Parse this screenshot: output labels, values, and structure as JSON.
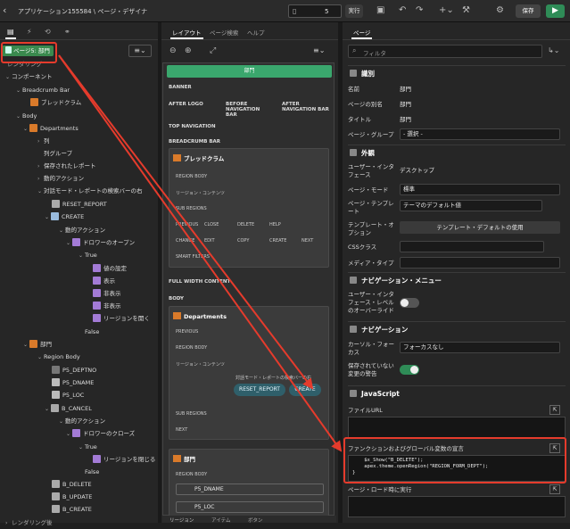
{
  "header": {
    "app_title": "アプリケーション155584 \\ ページ・デザイナ",
    "page_number": "5",
    "run_label": "実行",
    "save_label": "保存"
  },
  "left": {
    "page_chip": "ページ5: 部門",
    "items": [
      {
        "label": "レンダリング",
        "muted": true
      },
      {
        "label": "コンポーネント"
      },
      {
        "label": "Breadcrumb Bar"
      },
      {
        "label": "ブレッドクラム"
      },
      {
        "label": "Body"
      },
      {
        "label": "Departments"
      },
      {
        "label": "列"
      },
      {
        "label": "列グループ"
      },
      {
        "label": "保存されたレポート"
      },
      {
        "label": "動的アクション"
      },
      {
        "label": "対話モード・レポートの検索バーの右"
      },
      {
        "label": "RESET_REPORT"
      },
      {
        "label": "CREATE"
      },
      {
        "label": "動的アクション"
      },
      {
        "label": "ドロワーのオープン"
      },
      {
        "label": "True"
      },
      {
        "label": "値の設定"
      },
      {
        "label": "表示"
      },
      {
        "label": "非表示"
      },
      {
        "label": "非表示"
      },
      {
        "label": "リージョンを開く"
      },
      {
        "label": "False"
      },
      {
        "label": "部門"
      },
      {
        "label": "Region Body"
      },
      {
        "label": "P5_DEPTNO"
      },
      {
        "label": "P5_DNAME"
      },
      {
        "label": "P5_LOC"
      },
      {
        "label": "B_CANCEL"
      },
      {
        "label": "動的アクション"
      },
      {
        "label": "ドロワーのクローズ"
      },
      {
        "label": "True"
      },
      {
        "label": "リージョンを閉じる"
      },
      {
        "label": "False"
      },
      {
        "label": "B_DELETE"
      },
      {
        "label": "B_UPDATE"
      },
      {
        "label": "B_CREATE"
      },
      {
        "label": "レンダリング後"
      }
    ]
  },
  "center": {
    "tabs": [
      "レイアウト",
      "ページ検索",
      "ヘルプ"
    ],
    "page_title_bar": "部門",
    "sections": {
      "banner": "BANNER",
      "after_logo": "AFTER LOGO",
      "before_nav": "BEFORE NAVIGATION BAR",
      "after_nav": "AFTER NAVIGATION BAR",
      "top_nav": "TOP NAVIGATION",
      "breadcrumb_bar": "BREADCRUMB BAR",
      "full_width": "FULL WIDTH CONTENT",
      "body": "BODY"
    },
    "bc_region": {
      "title": "ブレッドクラム",
      "region_body": "REGION BODY",
      "region_content": "リージョン・コンテンツ",
      "sub_regions": "SUB REGIONS",
      "buttons": [
        "PREVIOUS",
        "CLOSE",
        "DELETE",
        "HELP",
        "CHANGE",
        "EDIT",
        "COPY",
        "CREATE",
        "NEXT"
      ],
      "smart_filters": "SMART FILTERS"
    },
    "dept_region": {
      "title": "Departments",
      "previous": "PREVIOUS",
      "region_body": "REGION BODY",
      "region_content": "リージョン・コンテンツ",
      "search_right": "対話モード・レポートの検索バーの右",
      "reset": "RESET_REPORT",
      "create": "CREATE",
      "sub_regions": "SUB REGIONS",
      "next": "NEXT"
    },
    "form_region": {
      "title": "部門",
      "region_body": "REGION BODY",
      "p5_dname": "P5_DNAME",
      "p5_loc": "P5_LOC"
    },
    "bottom_tabs": [
      "リージョン",
      "アイテム",
      "ボタン"
    ]
  },
  "right": {
    "tab": "ページ",
    "filter_placeholder": "フィルタ",
    "groups": {
      "identification": "識別",
      "appearance": "外観",
      "nav_menu": "ナビゲーション・メニュー",
      "navigation": "ナビゲーション",
      "javascript": "JavaScript"
    },
    "props": {
      "name_l": "名前",
      "name_v": "部門",
      "alias_l": "ページの別名",
      "alias_v": "部門",
      "title_l": "タイトル",
      "title_v": "部門",
      "group_l": "ページ・グループ",
      "group_v": "- 選択 -",
      "ui_l": "ユーザー・インタフェース",
      "ui_v": "デスクトップ",
      "mode_l": "ページ・モード",
      "mode_v": "標準",
      "template_l": "ページ・テンプレート",
      "template_v": "テーマのデフォルト値",
      "tmpl_opt_l": "テンプレート・オプション",
      "tmpl_opt_btn": "テンプレート・デフォルトの使用",
      "css_l": "CSSクラス",
      "css_v": "",
      "media_l": "メディア・タイプ",
      "media_v": "",
      "nav_ui_l": "ユーザー・インタフェース・レベルのオーバーライド",
      "cursor_l": "カーソル・フォーカス",
      "cursor_v": "フォーカスなし",
      "warn_l": "保存されていない変更の警告",
      "file_url_l": "ファイルURL",
      "global_l": "ファンクションおよびグローバル変数の宣言",
      "code": "    $x_Show(\"B_DELETE\");\n    apex.theme.openRegion(\"REGION_FORM_DEPT\");\n}",
      "onload_l": "ページ・ロード時に実行"
    }
  },
  "colors": {
    "accent": "#3aa76d",
    "annotation": "#e53b2c"
  }
}
